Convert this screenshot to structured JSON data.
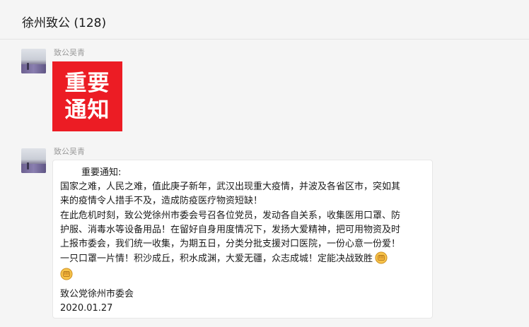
{
  "header": {
    "title": "徐州致公 (128)"
  },
  "messages": [
    {
      "sender": "致公吴青",
      "image_text": {
        "line1": "重要",
        "line2": "通知"
      }
    },
    {
      "sender": "致公吴青",
      "lines": [
        "重要通知:",
        "国家之难，人民之难，值此庚子新年，武汉出现重大疫情，并波及各省区市，突如其",
        "来的疫情令人措手不及，造成防疫医疗物资短缺！",
        "在此危机时刻，致公党徐州市委会号召各位党员，发动各自关系，收集医用口罩、防",
        "护服、消毒水等设备用品！在留好自身用度情况下，发扬大爱精神，把可用物资及时",
        "上报市委会，我们统一收集，为期五日，分类分批支援对口医院，一份心意一份爱！",
        "一只口罩一片情！积沙成丘，积水成渊，大爱无疆，众志成城！定能决战致胜"
      ],
      "signature": "致公党徐州市委会",
      "date": "2020.01.27",
      "emoji": "fist-emoji"
    }
  ]
}
